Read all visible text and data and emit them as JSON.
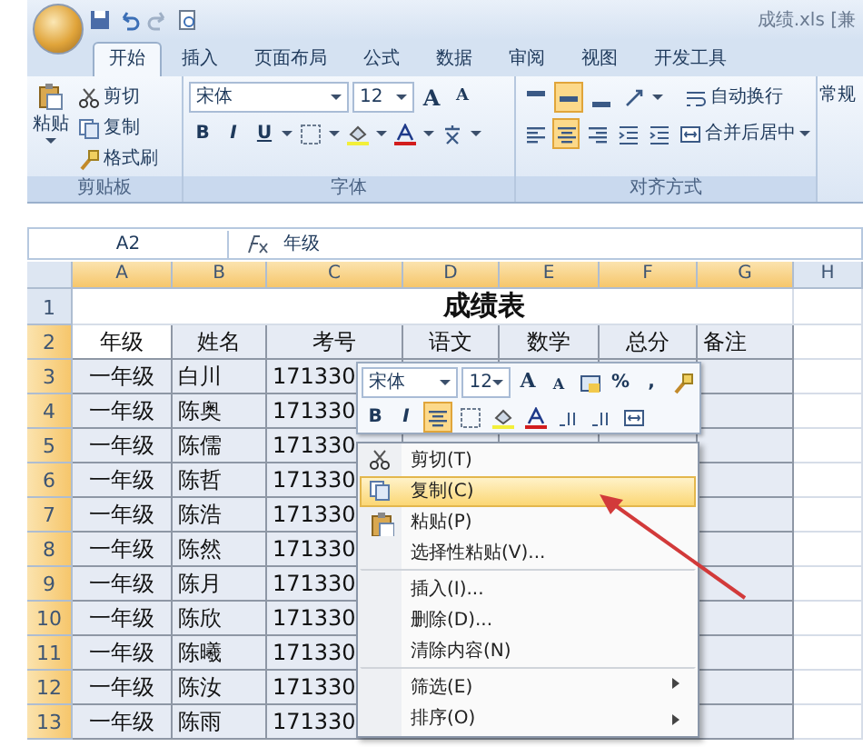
{
  "title_bar": {
    "title": "成绩.xls [兼"
  },
  "ribbon_tabs": [
    {
      "label": "开始",
      "selected": true
    },
    {
      "label": "插入",
      "selected": false
    },
    {
      "label": "页面布局",
      "selected": false
    },
    {
      "label": "公式",
      "selected": false
    },
    {
      "label": "数据",
      "selected": false
    },
    {
      "label": "审阅",
      "selected": false
    },
    {
      "label": "视图",
      "selected": false
    },
    {
      "label": "开发工具",
      "selected": false
    }
  ],
  "clipboard_group": {
    "paste": "粘贴",
    "cut": "剪切",
    "copy": "复制",
    "format_painter": "格式刷",
    "label": "剪贴板"
  },
  "font_group": {
    "font_name": "宋体",
    "font_size": "12",
    "grow": "A",
    "shrink": "A",
    "bold": "B",
    "italic": "I",
    "underline": "U",
    "label": "字体"
  },
  "alignment_group": {
    "vertical": [
      {
        "kind": "top",
        "selected": false
      },
      {
        "kind": "middle",
        "selected": true
      },
      {
        "kind": "bottom",
        "selected": false
      }
    ],
    "horizontal": [
      {
        "kind": "left",
        "selected": false
      },
      {
        "kind": "center",
        "selected": true
      },
      {
        "kind": "right",
        "selected": false
      }
    ],
    "wrap_text": "自动换行",
    "merge_center": "合并后居中",
    "label": "对齐方式"
  },
  "number_group": {
    "format": "常规"
  },
  "formula_bar": {
    "name_box": "A2",
    "content": "年级"
  },
  "sheet": {
    "columns": [
      {
        "label": "A",
        "selected": true
      },
      {
        "label": "B",
        "selected": true
      },
      {
        "label": "C",
        "selected": true
      },
      {
        "label": "D",
        "selected": true
      },
      {
        "label": "E",
        "selected": true
      },
      {
        "label": "F",
        "selected": true
      },
      {
        "label": "G",
        "selected": true
      },
      {
        "label": "H",
        "selected": false
      }
    ],
    "title_row": {
      "number": "1",
      "selected": false,
      "title": "成绩表"
    },
    "header_row": {
      "number": "2",
      "selected": true,
      "cells": [
        "年级",
        "姓名",
        "考号",
        "语文",
        "数学",
        "总分",
        "备注"
      ]
    },
    "rows": [
      {
        "number": "3",
        "selected": true,
        "grade": "一年级",
        "name": "白川",
        "id": "171330"
      },
      {
        "number": "4",
        "selected": true,
        "grade": "一年级",
        "name": "陈奥",
        "id": "171330"
      },
      {
        "number": "5",
        "selected": true,
        "grade": "一年级",
        "name": "陈儒",
        "id": "171330"
      },
      {
        "number": "6",
        "selected": true,
        "grade": "一年级",
        "name": "陈哲",
        "id": "171330"
      },
      {
        "number": "7",
        "selected": true,
        "grade": "一年级",
        "name": "陈浩",
        "id": "171330"
      },
      {
        "number": "8",
        "selected": true,
        "grade": "一年级",
        "name": "陈然",
        "id": "171330"
      },
      {
        "number": "9",
        "selected": true,
        "grade": "一年级",
        "name": "陈月",
        "id": "171330"
      },
      {
        "number": "10",
        "selected": true,
        "grade": "一年级",
        "name": "陈欣",
        "id": "171330"
      },
      {
        "number": "11",
        "selected": true,
        "grade": "一年级",
        "name": "陈曦",
        "id": "171330"
      },
      {
        "number": "12",
        "selected": true,
        "grade": "一年级",
        "name": "陈汝",
        "id": "171330"
      },
      {
        "number": "13",
        "selected": true,
        "grade": "一年级",
        "name": "陈雨",
        "id": "171330"
      }
    ]
  },
  "mini_toolbar": {
    "font_name": "宋体",
    "font_size": "12",
    "grow": "A",
    "shrink": "A",
    "percent": "%",
    "comma": ",",
    "bold": "B",
    "italic": "I",
    "center_selected": true
  },
  "context_menu": [
    {
      "kind": "cut",
      "label": "剪切(T)",
      "selected": false,
      "separator_before": false,
      "submenu": false
    },
    {
      "kind": "copy",
      "label": "复制(C)",
      "selected": true,
      "separator_before": false,
      "submenu": false
    },
    {
      "kind": "paste",
      "label": "粘贴(P)",
      "selected": false,
      "separator_before": false,
      "submenu": false
    },
    {
      "kind": "plain",
      "label": "选择性粘贴(V)...",
      "selected": false,
      "separator_before": false,
      "submenu": false
    },
    {
      "kind": "plain",
      "label": "插入(I)...",
      "selected": false,
      "separator_before": true,
      "submenu": false
    },
    {
      "kind": "plain",
      "label": "删除(D)...",
      "selected": false,
      "separator_before": false,
      "submenu": false
    },
    {
      "kind": "plain",
      "label": "清除内容(N)",
      "selected": false,
      "separator_before": false,
      "submenu": false
    },
    {
      "kind": "plain",
      "label": "筛选(E)",
      "selected": false,
      "separator_before": true,
      "submenu": true
    },
    {
      "kind": "plain",
      "label": "排序(O)",
      "selected": false,
      "separator_before": false,
      "submenu": true
    }
  ]
}
